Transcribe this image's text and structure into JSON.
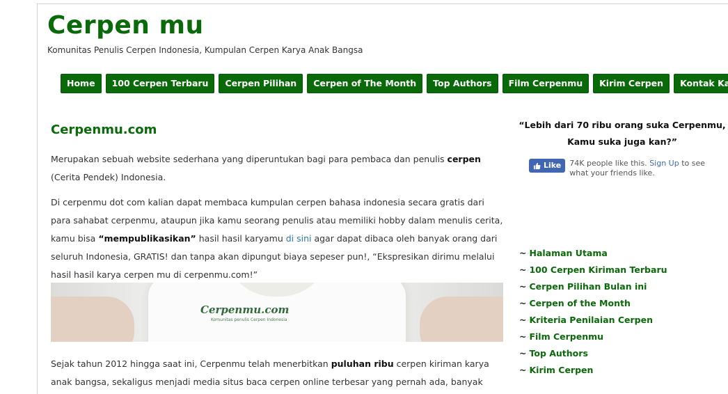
{
  "site": {
    "title": "Cerpen mu",
    "tagline": "Komunitas Penulis Cerpen Indonesia, Kumpulan Cerpen Karya Anak Bangsa"
  },
  "nav": [
    "Home",
    "100 Cerpen Terbaru",
    "Cerpen Pilihan",
    "Cerpen of The Month",
    "Top Authors",
    "Film Cerpenmu",
    "Kirim Cerpen",
    "Kontak Kami"
  ],
  "main": {
    "heading": "Cerpenmu.com",
    "p1_a": "Merupakan sebuah website sederhana yang diperuntukan bagi para pembaca dan penulis ",
    "p1_bold": "cerpen",
    "p1_b": " (Cerita Pendek) Indonesia.",
    "p2_a": "Di cerpenmu dot com kalian dapat membaca kumpulan cerpen bahasa indonesia secara gratis dari para sahabat cerpenmu, ataupun jika kamu seorang penulis atau memiliki hobby dalam menulis cerita, kamu bisa ",
    "p2_bold": "“mempublikasikan”",
    "p2_b": " hasil hasil karyamu ",
    "p2_link": "di sini",
    "p2_c": " agar dapat dibaca oleh banyak orang dari seluruh Indonesia, GRATIS! dan tanpa akan dipungut biaya sepeser pun!, “Ekspresikan dirimu melalui hasil hasil karya cerpen mu di cerpenmu.com!”",
    "banner_logo": "Cerpenmu.com",
    "banner_sub": "Komunitas penulis Cerpen Indonesia",
    "p3_a": "Sejak tahun 2012 hingga saat ini, Cerpenmu telah menerbitkan ",
    "p3_bold": "puluhan ribu",
    "p3_b": " cerpen kiriman karya anak bangsa, sekaligus menjadi media situs baca cerpen online terbesar yang pernah ada, banyak cerpen"
  },
  "sidebar": {
    "quote_line1": "“Lebih dari 70 ribu orang suka Cerpenmu,",
    "quote_line2": "Kamu suka juga kan?”",
    "fb_like_label": "Like",
    "fb_count_text": "74K people like this.",
    "fb_signup": "Sign Up",
    "fb_rest": " to see what your friends like.",
    "links": [
      "Halaman Utama",
      "100 Cerpen Kiriman Terbaru",
      "Cerpen Pilihan Bulan ini",
      "Cerpen of the Month",
      "Kriteria Penilaian Cerpen",
      "Film Cerpenmu",
      "Top Authors",
      "Kirim Cerpen"
    ],
    "link_prefix": "~"
  },
  "colors": {
    "brand_green": "#0a6a0a",
    "facebook_blue": "#4267b2"
  }
}
